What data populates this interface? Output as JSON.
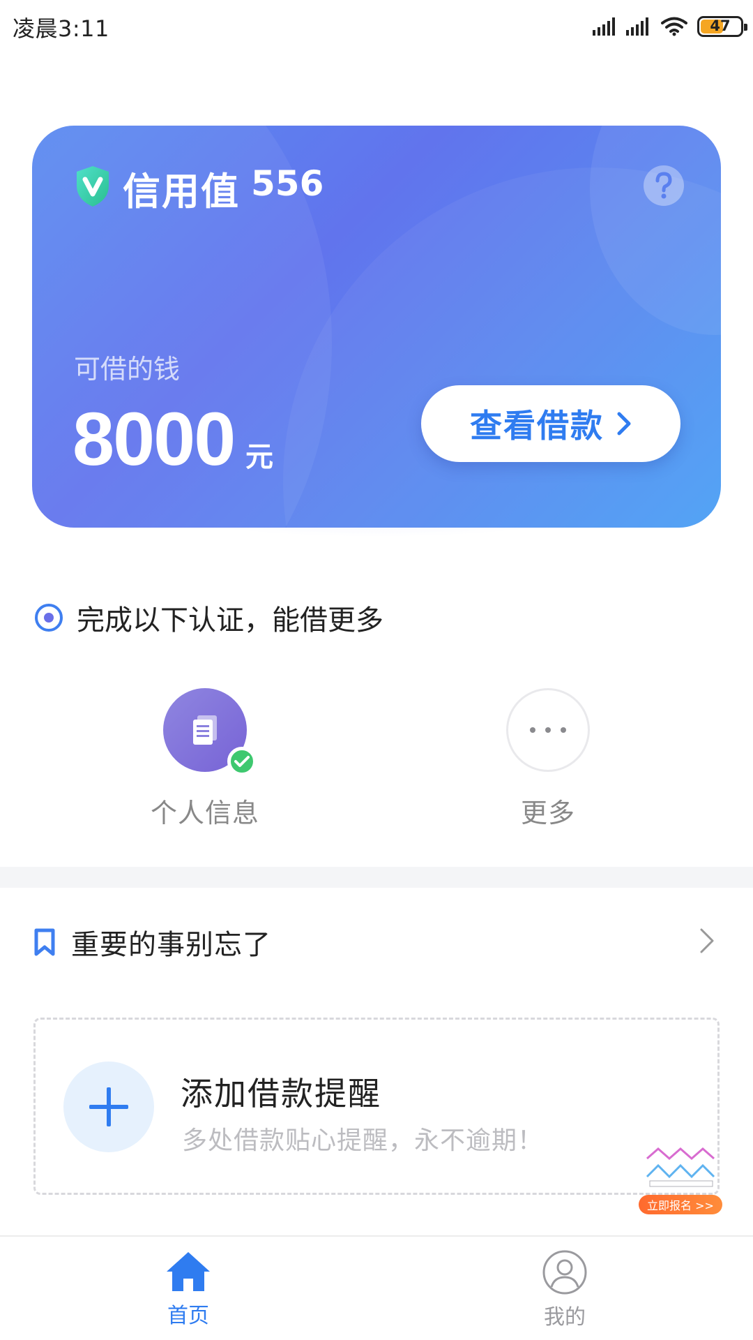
{
  "status_bar": {
    "time": "凌晨3:11",
    "battery": "47",
    "icons": [
      "signal-icon",
      "signal-icon",
      "wifi-icon",
      "battery-icon"
    ]
  },
  "credit_card": {
    "title": "信用值",
    "score": "556",
    "borrow_label": "可借的钱",
    "amount": "8000",
    "unit": "元",
    "view_button": "查看借款",
    "colors": {
      "gradient_start": "#6174ed",
      "gradient_end": "#4a9ff5",
      "button_text": "#2f7cf0"
    }
  },
  "verification": {
    "title": "完成以下认证，能借更多",
    "items": [
      {
        "label": "个人信息",
        "icon": "document-icon",
        "status": "verified"
      },
      {
        "label": "更多",
        "icon": "more-dots-icon"
      }
    ]
  },
  "reminder": {
    "title": "重要的事别忘了",
    "add_title": "添加借款提醒",
    "add_subtitle": "多处借款贴心提醒，永不逾期！"
  },
  "promo": {
    "label": "立即报名 >>"
  },
  "bottom_nav": {
    "items": [
      {
        "label": "首页",
        "icon": "home-icon",
        "active": true
      },
      {
        "label": "我的",
        "icon": "user-icon",
        "active": false
      }
    ]
  }
}
